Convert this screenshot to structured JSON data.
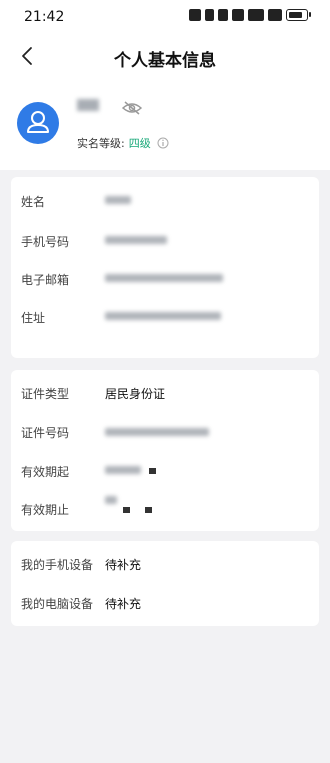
{
  "status": {
    "time": "21:42"
  },
  "nav": {
    "title": "个人基本信息"
  },
  "profile": {
    "level_label": "实名等级:",
    "level_value": "四级"
  },
  "personal": [
    {
      "label": "姓名"
    },
    {
      "label": "手机号码"
    },
    {
      "label": "电子邮箱"
    },
    {
      "label": "住址"
    }
  ],
  "certificate": [
    {
      "label": "证件类型",
      "value": "居民身份证"
    },
    {
      "label": "证件号码"
    },
    {
      "label": "有效期起"
    },
    {
      "label": "有效期止"
    }
  ],
  "devices": [
    {
      "label": "我的手机设备",
      "value": "待补充"
    },
    {
      "label": "我的电脑设备",
      "value": "待补充"
    }
  ],
  "colors": {
    "accent": "#2f7be6",
    "level": "#18a878",
    "bg": "#f2f2f4"
  },
  "icons": {
    "back": "chevron-left-icon",
    "eye": "eye-off-icon",
    "info": "info-icon",
    "avatar": "user-icon"
  }
}
